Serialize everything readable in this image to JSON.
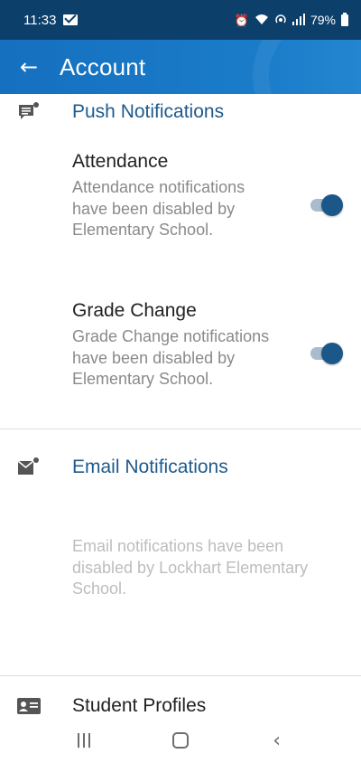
{
  "status_bar": {
    "time": "11:33",
    "battery_percent": "79%",
    "icons": [
      "mail-icon",
      "alarm-icon",
      "wifi-icon",
      "hotspot-icon",
      "signal-icon",
      "battery-icon"
    ]
  },
  "app_bar": {
    "title": "Account",
    "back_icon": "back-arrow-icon"
  },
  "push_notifications": {
    "title": "Push Notifications",
    "icon": "chat-notification-icon",
    "items": [
      {
        "title": "Attendance",
        "description": "Attendance notifications have been disabled by Elementary School.",
        "enabled": true
      },
      {
        "title": "Grade Change",
        "description": "Grade Change notifications have been disabled by Elementary School.",
        "enabled": true
      }
    ]
  },
  "email_notifications": {
    "title": "Email Notifications",
    "icon": "mail-notification-icon",
    "description": "Email notifications have been disabled by Lockhart Elementary School."
  },
  "student_profiles": {
    "title": "Student Profiles",
    "icon": "id-card-icon"
  },
  "nav_bar": {
    "icons": [
      "recents-icon",
      "home-icon",
      "back-icon"
    ]
  },
  "colors": {
    "status_bar": "#0d3f6b",
    "app_bar": "#1a77c4",
    "section_title": "#1f5a8c",
    "toggle_thumb": "#1c5789",
    "toggle_track": "#a8bccd"
  }
}
